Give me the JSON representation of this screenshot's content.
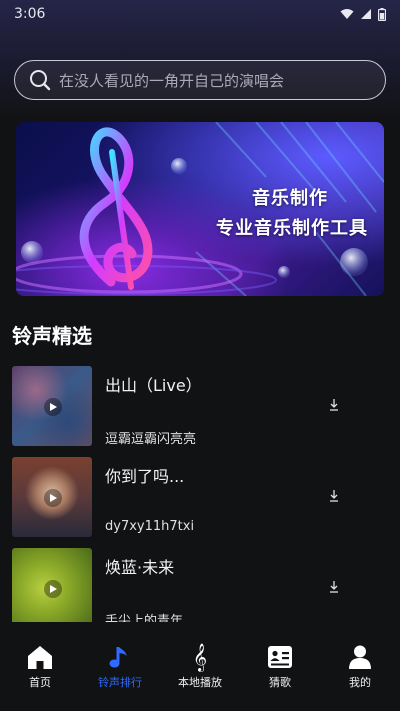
{
  "status_bar": {
    "time": "3:06"
  },
  "search": {
    "placeholder": "在没人看见的一角开自己的演唱会"
  },
  "banner": {
    "line1": "音乐制作",
    "line2": "专业音乐制作工具"
  },
  "section": {
    "title": "铃声精选"
  },
  "songs": [
    {
      "title": "出山（Live）",
      "artist": "逗霸逗霸闪亮亮"
    },
    {
      "title": "你到了吗...",
      "artist": "dy7xy11h7txi"
    },
    {
      "title": "焕蓝·未来",
      "artist": "手尖上的青年"
    }
  ],
  "tabs": [
    {
      "label": "首页",
      "icon": "home-icon"
    },
    {
      "label": "铃声排行",
      "icon": "music-note-icon",
      "active": true
    },
    {
      "label": "本地播放",
      "icon": "treble-clef-icon"
    },
    {
      "label": "猜歌",
      "icon": "id-card-icon"
    },
    {
      "label": "我的",
      "icon": "user-icon"
    }
  ],
  "colors": {
    "accent": "#2f6bff",
    "background": "#111214"
  }
}
